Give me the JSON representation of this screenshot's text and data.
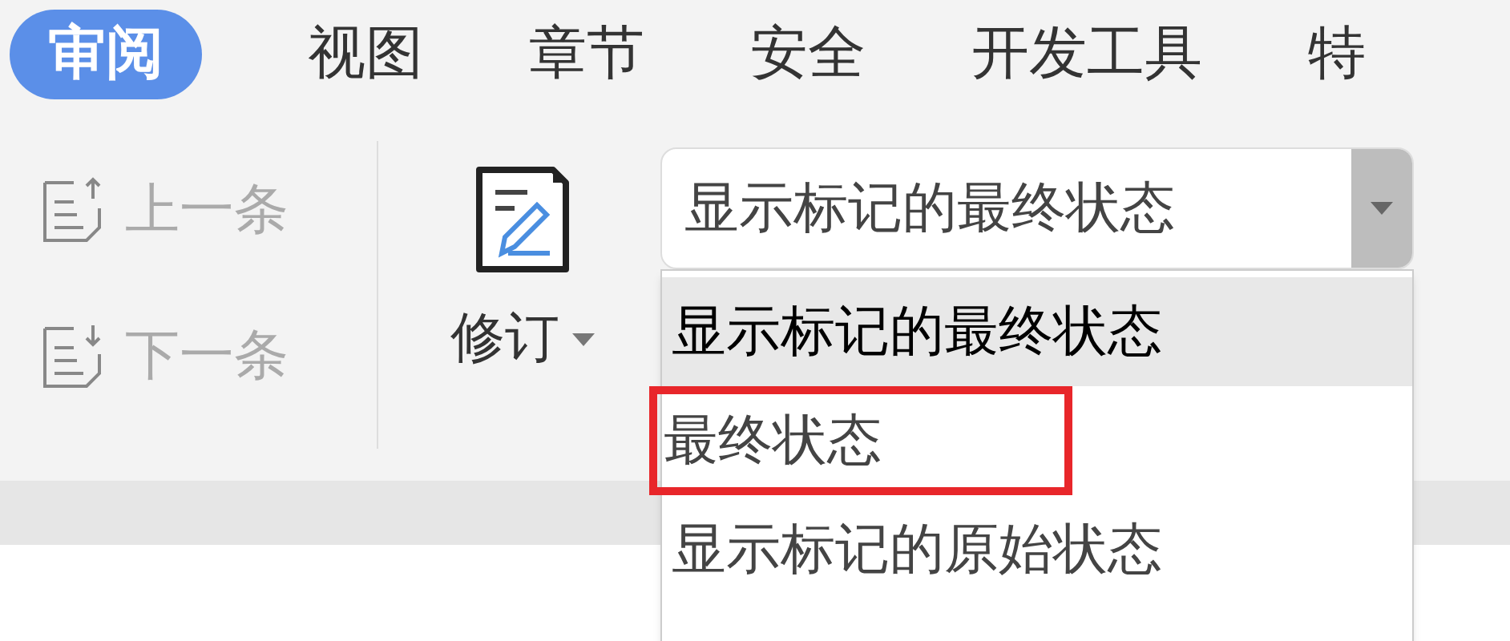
{
  "tabs": [
    {
      "label": "审阅",
      "selected": true
    },
    {
      "label": "视图",
      "selected": false
    },
    {
      "label": "章节",
      "selected": false
    },
    {
      "label": "安全",
      "selected": false
    },
    {
      "label": "开发工具",
      "selected": false
    },
    {
      "label": "特",
      "selected": false
    }
  ],
  "nav_buttons": [
    {
      "label": "上一条",
      "kind": "up",
      "disabled": true
    },
    {
      "label": "下一条",
      "kind": "down",
      "disabled": true
    }
  ],
  "revise_button": {
    "label": "修订"
  },
  "markup_dropdown": {
    "value": "显示标记的最终状态",
    "expanded": true,
    "options": [
      {
        "label": "显示标记的最终状态",
        "selected": true,
        "highlighted_by_annotation": false
      },
      {
        "label": "最终状态",
        "selected": false,
        "highlighted_by_annotation": true
      },
      {
        "label": "显示标记的原始状态",
        "selected": false,
        "highlighted_by_annotation": false
      }
    ]
  }
}
